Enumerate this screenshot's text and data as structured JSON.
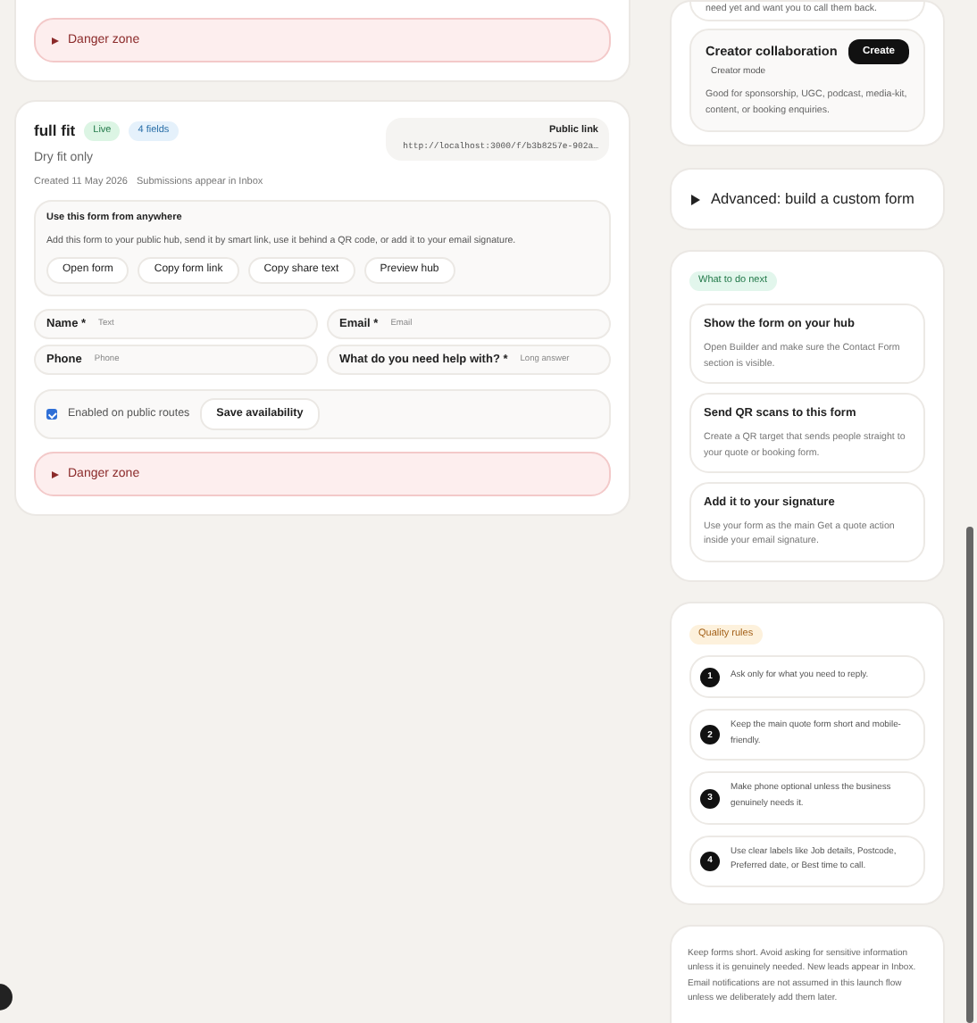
{
  "top_form_card": {
    "danger_zone": {
      "label": "Danger zone",
      "expanded": false
    }
  },
  "form_card": {
    "title": "full fit",
    "status_badge": "Live",
    "fields_badge": "4 fields",
    "subtitle": "Dry fit only",
    "created": "Created 11 May 2026",
    "inbox_note": "Submissions appear in Inbox",
    "public_link": {
      "label": "Public link",
      "url": "http://localhost:3000/f/b3b8257e-902a…"
    },
    "share_panel": {
      "title": "Use this form from anywhere",
      "description": "Add this form to your public hub, send it by smart link, use it behind a QR code, or add it to your email signature.",
      "buttons": [
        "Open form",
        "Copy form link",
        "Copy share text",
        "Preview hub"
      ]
    },
    "fields": [
      {
        "label": "Name *",
        "type": "Text"
      },
      {
        "label": "Email *",
        "type": "Email"
      },
      {
        "label": "Phone",
        "type": "Phone"
      },
      {
        "label": "What do you need help with? *",
        "type": "Long answer"
      }
    ],
    "availability": {
      "label": "Enabled on public routes",
      "enabled": true,
      "button": "Save availability"
    },
    "danger_zone": {
      "label": "Danger zone",
      "expanded": false
    }
  },
  "templates_card": {
    "previous_description": "need yet and want you to call them back.",
    "template": {
      "title": "Creator collaboration",
      "tag": "Creator mode",
      "description": "Good for sponsorship, UGC, podcast, media-kit, content, or booking enquiries.",
      "button": "Create"
    }
  },
  "advanced": {
    "label": "Advanced: build a custom form",
    "expanded": false
  },
  "next_steps": {
    "badge": "What to do next",
    "items": [
      {
        "title": "Show the form on your hub",
        "description": "Open Builder and make sure the Contact Form section is visible."
      },
      {
        "title": "Send QR scans to this form",
        "description": "Create a QR target that sends people straight to your quote or booking form."
      },
      {
        "title": "Add it to your signature",
        "description": "Use your form as the main Get a quote action inside your email signature."
      }
    ]
  },
  "quality_rules": {
    "badge": "Quality rules",
    "items": [
      {
        "number": "1",
        "text": "Ask only for what you need to reply."
      },
      {
        "number": "2",
        "text": "Keep the main quote form short and mobile-friendly."
      },
      {
        "number": "3",
        "text": "Make phone optional unless the business genuinely needs it."
      },
      {
        "number": "4",
        "text": "Use clear labels like Job details, Postcode, Preferred date, or Best time to call."
      }
    ]
  },
  "note": "Keep forms short. Avoid asking for sensitive information unless it is genuinely needed. New leads appear in Inbox. Email notifications are not assumed in this launch flow unless we deliberately add them later."
}
